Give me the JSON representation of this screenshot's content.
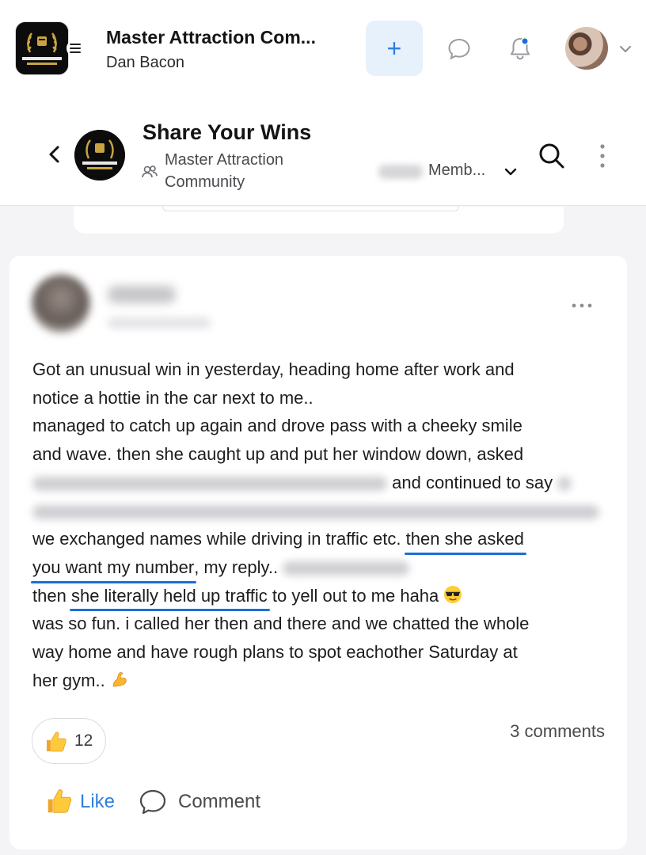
{
  "app": {
    "title": "Master Attraction Com...",
    "user_name": "Dan Bacon",
    "logo_text": "MASTER ATTRACTION COMMUNITY",
    "colors": {
      "accent": "#2f7fdc",
      "accent_soft": "#e6f1fc",
      "notification_dot": "#1b6fd6",
      "highlight": "#1b6fd6"
    },
    "icons": [
      "menu-icon",
      "plus-icon",
      "chat-icon",
      "bell-icon",
      "chevron-down-icon"
    ]
  },
  "group": {
    "title": "Share Your Wins",
    "community_name": "Master Attraction Community",
    "members_label": "Memb...",
    "icons": [
      "back-icon",
      "group-icon",
      "search-icon",
      "more-vertical-icon"
    ]
  },
  "post": {
    "body": {
      "line1": "Got an unusual win in yesterday, heading home after work and",
      "line2": "notice a hottie in the car next to me..",
      "line3": "managed to catch up again and drove pass with a cheeky smile",
      "line4": "and wave. then she caught up and put her window down, asked",
      "line5_visible": "and continued to say",
      "line7_start": "we exchanged names while driving in traffic etc.",
      "line7_highlight": "then she asked",
      "line8_highlight": "you want my number",
      "line8_rest": ", my reply..",
      "line9_start": "then",
      "line9_highlight": "she literally held up traffic",
      "line9_end": "to yell out to me haha",
      "line10": "was so fun. i called her then and there and we chatted the whole",
      "line11": "way home and have rough plans to spot eachother Saturday at",
      "line12": "her gym..",
      "emoji_sunglasses": "sunglasses-emoji",
      "emoji_flex": "flexed-biceps-emoji"
    },
    "reaction_count": "12",
    "comments_count": "3 comments",
    "like_label": "Like",
    "comment_label": "Comment"
  }
}
